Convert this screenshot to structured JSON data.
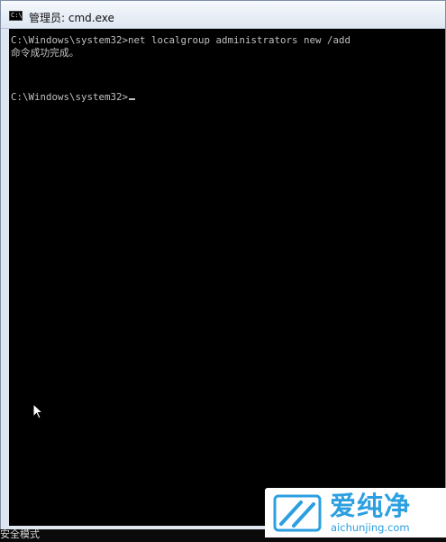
{
  "window": {
    "title": "管理员: cmd.exe",
    "icon_label": "C:\\",
    "icon": "console-icon"
  },
  "console": {
    "lines": [
      "C:\\Windows\\system32>net localgroup administrators new /add",
      "命令成功完成。",
      "C:\\Windows\\system32>"
    ],
    "text_color": "#c0c0c0",
    "background": "#000000"
  },
  "status": {
    "safe_mode": "安全模式"
  },
  "watermark": {
    "name": "爱纯净",
    "url": "aichunjing.com",
    "color": "#2b9fe0"
  }
}
